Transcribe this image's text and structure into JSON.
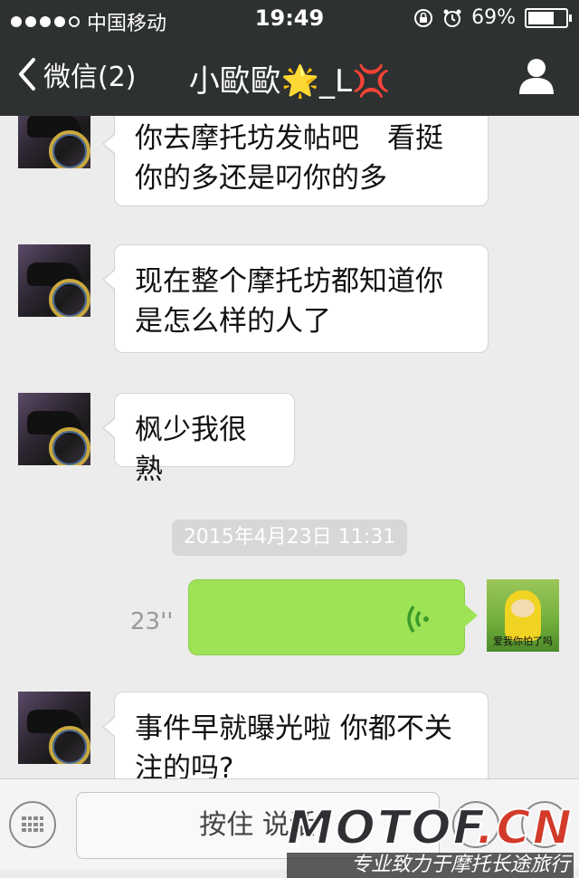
{
  "status": {
    "carrier": "中国移动",
    "time": "19:49",
    "battery": "69%",
    "battery_level": 0.69
  },
  "header": {
    "back_label": "微信(2)",
    "title": "小歐歐🌟_L💢"
  },
  "messages": [
    {
      "side": "left",
      "text": "你去摩托坊发帖吧　看挺你的多还是叼你的多"
    },
    {
      "side": "left",
      "text": "现在整个摩托坊都知道你是怎么样的人了"
    },
    {
      "side": "left",
      "text": "枫少我很熟"
    },
    {
      "side": "right",
      "type": "voice",
      "duration": "23''"
    },
    {
      "side": "left",
      "text": "事件早就曝光啦 你都不关注的吗?"
    }
  ],
  "timestamp": "2015年4月23日 11:31",
  "avatar_right_caption": "爱我你怕了吗",
  "input": {
    "hold_to_talk": "按住 说话"
  },
  "watermark": {
    "brand": "MOTOF",
    "brand_suffix": ".CN",
    "tagline": "专业致力于摩托长途旅行"
  },
  "colors": {
    "header_bg": "#2e3132",
    "chat_bg": "#ececec",
    "voice_bubble": "#9ee356"
  }
}
